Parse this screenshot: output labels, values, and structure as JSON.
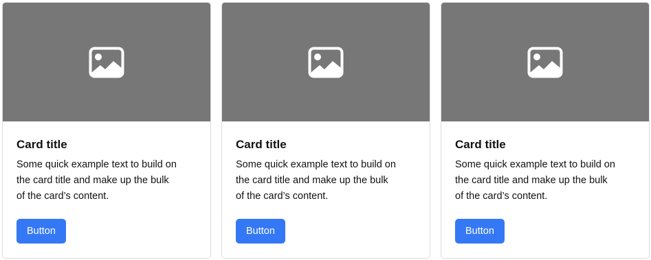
{
  "colors": {
    "image_placeholder_bg": "#777777",
    "button_bg": "#3478f6",
    "button_text": "#ffffff",
    "card_border": "#dcdcdc",
    "text": "#111111"
  },
  "cards": [
    {
      "image_icon": "image-icon",
      "title": "Card title",
      "text": "Some quick example text to build on the card title and make up the bulk of the card’s content.",
      "button_label": "Button"
    },
    {
      "image_icon": "image-icon",
      "title": "Card title",
      "text": "Some quick example text to build on the card title and make up the bulk of the card’s content.",
      "button_label": "Button"
    },
    {
      "image_icon": "image-icon",
      "title": "Card title",
      "text": "Some quick example text to build on the card title and make up the bulk of the card’s content.",
      "button_label": "Button"
    }
  ]
}
